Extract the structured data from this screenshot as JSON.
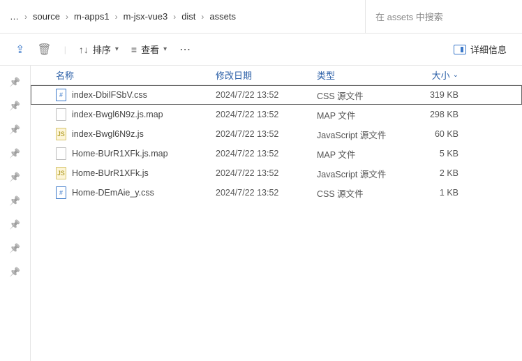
{
  "breadcrumb": [
    {
      "label": "…"
    },
    {
      "label": "source"
    },
    {
      "label": "m-apps1"
    },
    {
      "label": "m-jsx-vue3"
    },
    {
      "label": "dist"
    },
    {
      "label": "assets"
    }
  ],
  "search": {
    "placeholder": "在 assets 中搜索"
  },
  "toolbar": {
    "sort": "排序",
    "view": "查看",
    "details": "详细信息"
  },
  "columns": {
    "name": "名称",
    "date": "修改日期",
    "type": "类型",
    "size": "大小"
  },
  "files": [
    {
      "name": "index-DbilFSbV.css",
      "date": "2024/7/22 13:52",
      "type": "CSS 源文件",
      "size": "319 KB",
      "icon": "css",
      "selected": true
    },
    {
      "name": "index-Bwgl6N9z.js.map",
      "date": "2024/7/22 13:52",
      "type": "MAP 文件",
      "size": "298 KB",
      "icon": "map",
      "selected": false
    },
    {
      "name": "index-Bwgl6N9z.js",
      "date": "2024/7/22 13:52",
      "type": "JavaScript 源文件",
      "size": "60 KB",
      "icon": "js",
      "selected": false
    },
    {
      "name": "Home-BUrR1XFk.js.map",
      "date": "2024/7/22 13:52",
      "type": "MAP 文件",
      "size": "5 KB",
      "icon": "map",
      "selected": false
    },
    {
      "name": "Home-BUrR1XFk.js",
      "date": "2024/7/22 13:52",
      "type": "JavaScript 源文件",
      "size": "2 KB",
      "icon": "js",
      "selected": false
    },
    {
      "name": "Home-DEmAie_y.css",
      "date": "2024/7/22 13:52",
      "type": "CSS 源文件",
      "size": "1 KB",
      "icon": "css",
      "selected": false
    }
  ],
  "pin_count": 9
}
